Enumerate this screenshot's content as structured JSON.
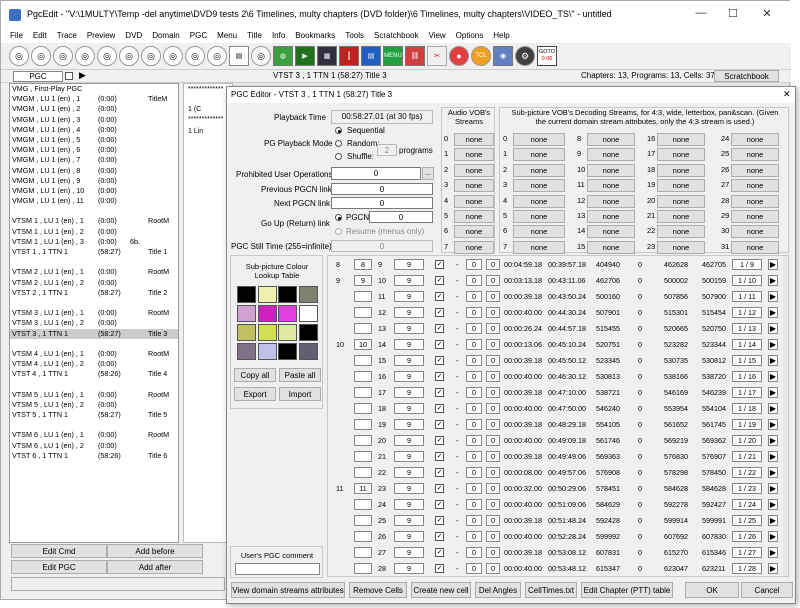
{
  "app": {
    "title": "PgcEdit -  \"V:\\1MULTY\\Temp -del anytime\\DVD9 tests 2\\6 Timelines, multy chapters (DVD folder)\\6 Timelines, multy chapters\\VIDEO_TS\\\" - untitled",
    "minimize": "—",
    "maximize": "☐",
    "close": "✕"
  },
  "menu": [
    "File",
    "Edit",
    "Trace",
    "Preview",
    "DVD",
    "Domain",
    "PGC",
    "Menu",
    "Title",
    "Info",
    "Bookmarks",
    "Tools",
    "Scratchbook",
    "View",
    "Options",
    "Help"
  ],
  "toolbar": {
    "goto_label": "GOTO",
    "goto_value": "0 06",
    "menu_btn": "MENU",
    "tcl_btn": "TCL"
  },
  "infobar": {
    "pgc_label": "PGC",
    "current": "VTST 3 , 1    TTN 1   (58:27)   Title 3",
    "stats": "Chapters: 13,  Programs: 13,  Cells: 37",
    "scratchbook": "Scratchbook"
  },
  "left_list": [
    {
      "a": "VMG , First-Play PGC",
      "b": "",
      "c": "",
      "d": ""
    },
    {
      "a": "VMGM , LU 1 (en) , 1",
      "b": "(0:00)",
      "c": "",
      "d": "TitleM"
    },
    {
      "a": "VMGM , LU 1 (en) , 2",
      "b": "(0:00)",
      "c": "",
      "d": ""
    },
    {
      "a": "VMGM , LU 1 (en) , 3",
      "b": "(0:00)",
      "c": "",
      "d": ""
    },
    {
      "a": "VMGM , LU 1 (en) , 4",
      "b": "(0:00)",
      "c": "",
      "d": ""
    },
    {
      "a": "VMGM , LU 1 (en) , 5",
      "b": "(0:00)",
      "c": "",
      "d": ""
    },
    {
      "a": "VMGM , LU 1 (en) , 6",
      "b": "(0:00)",
      "c": "",
      "d": ""
    },
    {
      "a": "VMGM , LU 1 (en) , 7",
      "b": "(0:00)",
      "c": "",
      "d": ""
    },
    {
      "a": "VMGM , LU 1 (en) , 8",
      "b": "(0:00)",
      "c": "",
      "d": ""
    },
    {
      "a": "VMGM , LU 1 (en) , 9",
      "b": "(0:00)",
      "c": "",
      "d": ""
    },
    {
      "a": "VMGM , LU 1 (en) , 10",
      "b": "(0:00)",
      "c": "",
      "d": ""
    },
    {
      "a": "VMGM , LU 1 (en) , 11",
      "b": "(0:00)",
      "c": "",
      "d": ""
    },
    null,
    {
      "a": "VTSM 1 , LU 1 (en) , 1",
      "b": "(0:00)",
      "c": "",
      "d": "RootM"
    },
    {
      "a": "VTSM 1 , LU 1 (en) , 2",
      "b": "(0:00)",
      "c": "",
      "d": ""
    },
    {
      "a": "VTSM 1 , LU 1 (en) , 3",
      "b": "(0:00)",
      "c": "6b.",
      "d": ""
    },
    {
      "a": "VTST 1 , 1     TTN 1",
      "b": "(58:27)",
      "c": "",
      "d": "Title 1"
    },
    null,
    {
      "a": "VTSM 2 , LU 1 (en) , 1",
      "b": "(0:00)",
      "c": "",
      "d": "RootM"
    },
    {
      "a": "VTSM 2 , LU 1 (en) , 2",
      "b": "(0:00)",
      "c": "",
      "d": ""
    },
    {
      "a": "VTST 2 , 1     TTN 1",
      "b": "(58:27)",
      "c": "",
      "d": "Title 2"
    },
    null,
    {
      "a": "VTSM 3 , LU 1 (en) , 1",
      "b": "(0:00)",
      "c": "",
      "d": "RootM"
    },
    {
      "a": "VTSM 3 , LU 1 (en) , 2",
      "b": "(0:00)",
      "c": "",
      "d": ""
    },
    {
      "a": "VTST 3 , 1     TTN 1",
      "b": "(58:27)",
      "c": "",
      "d": "Title 3",
      "sel": true
    },
    null,
    {
      "a": "VTSM 4 , LU 1 (en) , 1",
      "b": "(0:00)",
      "c": "",
      "d": "RootM"
    },
    {
      "a": "VTSM 4 , LU 1 (en) , 2",
      "b": "(0:00)",
      "c": "",
      "d": ""
    },
    {
      "a": "VTST 4 , 1     TTN 1",
      "b": "(58:26)",
      "c": "",
      "d": "Title 4"
    },
    null,
    {
      "a": "VTSM 5 , LU 1 (en) , 1",
      "b": "(0:00)",
      "c": "",
      "d": "RootM"
    },
    {
      "a": "VTSM 5 , LU 1 (en) , 2",
      "b": "(0:00)",
      "c": "",
      "d": ""
    },
    {
      "a": "VTST 5 , 1     TTN 1",
      "b": "(58:27)",
      "c": "",
      "d": "Title 5"
    },
    null,
    {
      "a": "VTSM 6 , LU 1 (en) , 1",
      "b": "(0:00)",
      "c": "",
      "d": "RootM"
    },
    {
      "a": "VTSM 6 , LU 1 (en) , 2",
      "b": "(0:00)",
      "c": "",
      "d": ""
    },
    {
      "a": "VTST 6 , 1     TTN 1",
      "b": "(58:26)",
      "c": "",
      "d": "Title 6"
    }
  ],
  "left_buttons": {
    "edit_cmd": "Edit Cmd",
    "add_before": "Add before",
    "edit_pgc": "Edit PGC",
    "add_after": "Add after"
  },
  "bg_text": {
    "stars1": "*************",
    "stars2": "*************",
    "line1": "1   (C",
    "line2": "1   Lin"
  },
  "dialog": {
    "title": "PGC Editor - VTST 3 , 1    TTN 1   (58:27)   Title 3",
    "playback_time_label": "Playback Time",
    "playback_time": "00:58:27.01 (at 30 fps)",
    "pg_mode_label": "PG Playback Mode",
    "sequential": "Sequential",
    "random": "Random:",
    "shuffle": "Shuffle:",
    "programs_value": "2",
    "programs_label": "programs",
    "prohibited_label": "Prohibited User Operations",
    "prohibited_value": "0",
    "prohibited_btn": "...",
    "prev_label": "Previous PGCN link",
    "prev_value": "0",
    "next_label": "Next PGCN link",
    "next_value": "0",
    "goup_label": "Go Up (Return) link",
    "pgcn_label": "PGCN",
    "pgcn_value": "0",
    "resume_label": "Resume (menus only)",
    "still_label": "PGC Still Time (255=infinite)",
    "still_value": "0",
    "audio_header": "Audio VOB's Streams",
    "audio": [
      [
        "0",
        "none"
      ],
      [
        "1",
        "none"
      ],
      [
        "2",
        "none"
      ],
      [
        "3",
        "none"
      ],
      [
        "4",
        "none"
      ],
      [
        "5",
        "none"
      ],
      [
        "6",
        "none"
      ],
      [
        "7",
        "none"
      ]
    ],
    "sub_header": "Sub-picture VOB's Decoding Streams, for 4:3, wide, letterbox, pan&scan. (Given the current domain stream attributes, only the 4:3 stream is used.)",
    "sub_cols": [
      [
        [
          "0",
          "none"
        ],
        [
          "1",
          "none"
        ],
        [
          "2",
          "none"
        ],
        [
          "3",
          "none"
        ],
        [
          "4",
          "none"
        ],
        [
          "5",
          "none"
        ],
        [
          "6",
          "none"
        ],
        [
          "7",
          "none"
        ]
      ],
      [
        [
          "8",
          "none"
        ],
        [
          "9",
          "none"
        ],
        [
          "10",
          "none"
        ],
        [
          "11",
          "none"
        ],
        [
          "12",
          "none"
        ],
        [
          "13",
          "none"
        ],
        [
          "14",
          "none"
        ],
        [
          "15",
          "none"
        ]
      ],
      [
        [
          "16",
          "none"
        ],
        [
          "17",
          "none"
        ],
        [
          "18",
          "none"
        ],
        [
          "19",
          "none"
        ],
        [
          "20",
          "none"
        ],
        [
          "21",
          "none"
        ],
        [
          "22",
          "none"
        ],
        [
          "23",
          "none"
        ]
      ],
      [
        [
          "24",
          "none"
        ],
        [
          "25",
          "none"
        ],
        [
          "26",
          "none"
        ],
        [
          "27",
          "none"
        ],
        [
          "28",
          "none"
        ],
        [
          "29",
          "none"
        ],
        [
          "30",
          "none"
        ],
        [
          "31",
          "none"
        ]
      ]
    ],
    "clut_title": "Sub-picture Colour Lookup Table",
    "clut_colors": [
      "#000000",
      "#f0f0b0",
      "#000000",
      "#808070",
      "#d0a0d0",
      "#d020c0",
      "#e040e0",
      "#ffffff",
      "#c0c060",
      "#d0e050",
      "#e0e8a0",
      "#000000",
      "#807088",
      "#c0c0e8",
      "#000000",
      "#606070"
    ],
    "copy_all": "Copy all",
    "paste_all": "Paste all",
    "export": "Export",
    "import": "Import",
    "comment_label": "User's PGC comment",
    "rows": [
      {
        "ch": "8",
        "pg": "8",
        "cell": "9",
        "v": "9",
        "a": "0",
        "b": "0",
        "t1": "00:04:59.18",
        "t2": "00:39:57.18",
        "s1": "404940",
        "s2": "0",
        "s3": "462628",
        "s4": "462705",
        "frac": "1 / 9"
      },
      {
        "ch": "9",
        "pg": "9",
        "cell": "10",
        "v": "9",
        "a": "0",
        "b": "0",
        "t1": "00:03:13.18",
        "t2": "00:43:11.06",
        "s1": "462706",
        "s2": "0",
        "s3": "500002",
        "s4": "500159",
        "frac": "1 / 10"
      },
      {
        "ch": "",
        "pg": "",
        "cell": "11",
        "v": "9",
        "a": "0",
        "b": "0",
        "t1": "00:00:39.18",
        "t2": "00:43:50.24",
        "s1": "500160",
        "s2": "0",
        "s3": "507856",
        "s4": "507900",
        "frac": "1 / 11"
      },
      {
        "ch": "",
        "pg": "",
        "cell": "12",
        "v": "9",
        "a": "0",
        "b": "0",
        "t1": "00:00:40.00",
        "t2": "00:44:30.24",
        "s1": "507901",
        "s2": "0",
        "s3": "515301",
        "s4": "515454",
        "frac": "1 / 12"
      },
      {
        "ch": "",
        "pg": "",
        "cell": "13",
        "v": "9",
        "a": "0",
        "b": "0",
        "t1": "00:00:26.24",
        "t2": "00:44:57.18",
        "s1": "515455",
        "s2": "0",
        "s3": "520665",
        "s4": "520750",
        "frac": "1 / 13"
      },
      {
        "ch": "10",
        "pg": "10",
        "cell": "14",
        "v": "9",
        "a": "0",
        "b": "0",
        "t1": "00:00:13.06",
        "t2": "00:45:10.24",
        "s1": "520751",
        "s2": "0",
        "s3": "523282",
        "s4": "523344",
        "frac": "1 / 14"
      },
      {
        "ch": "",
        "pg": "",
        "cell": "15",
        "v": "9",
        "a": "0",
        "b": "0",
        "t1": "00:00:39.18",
        "t2": "00:45:50.12",
        "s1": "523345",
        "s2": "0",
        "s3": "530735",
        "s4": "530812",
        "frac": "1 / 15"
      },
      {
        "ch": "",
        "pg": "",
        "cell": "16",
        "v": "9",
        "a": "0",
        "b": "0",
        "t1": "00:00:40.00",
        "t2": "00:46:30.12",
        "s1": "530813",
        "s2": "0",
        "s3": "538166",
        "s4": "538720",
        "frac": "1 / 16"
      },
      {
        "ch": "",
        "pg": "",
        "cell": "17",
        "v": "9",
        "a": "0",
        "b": "0",
        "t1": "00:00:39.18",
        "t2": "00:47:10.00",
        "s1": "538721",
        "s2": "0",
        "s3": "546169",
        "s4": "546239",
        "frac": "1 / 17"
      },
      {
        "ch": "",
        "pg": "",
        "cell": "18",
        "v": "9",
        "a": "0",
        "b": "0",
        "t1": "00:00:40.00",
        "t2": "00:47:50.00",
        "s1": "546240",
        "s2": "0",
        "s3": "553954",
        "s4": "554104",
        "frac": "1 / 18"
      },
      {
        "ch": "",
        "pg": "",
        "cell": "19",
        "v": "9",
        "a": "0",
        "b": "0",
        "t1": "00:00:39.18",
        "t2": "00:48:29.18",
        "s1": "554105",
        "s2": "0",
        "s3": "561652",
        "s4": "561745",
        "frac": "1 / 19"
      },
      {
        "ch": "",
        "pg": "",
        "cell": "20",
        "v": "9",
        "a": "0",
        "b": "0",
        "t1": "00:00:40.00",
        "t2": "00:49:09.18",
        "s1": "561746",
        "s2": "0",
        "s3": "569219",
        "s4": "569362",
        "frac": "1 / 20"
      },
      {
        "ch": "",
        "pg": "",
        "cell": "21",
        "v": "9",
        "a": "0",
        "b": "0",
        "t1": "00:00:39.18",
        "t2": "00:49:49.06",
        "s1": "569363",
        "s2": "0",
        "s3": "576830",
        "s4": "576907",
        "frac": "1 / 21"
      },
      {
        "ch": "",
        "pg": "",
        "cell": "22",
        "v": "9",
        "a": "0",
        "b": "0",
        "t1": "00:00:08.00",
        "t2": "00:49:57.06",
        "s1": "576908",
        "s2": "0",
        "s3": "578298",
        "s4": "578450",
        "frac": "1 / 22"
      },
      {
        "ch": "11",
        "pg": "11",
        "cell": "23",
        "v": "9",
        "a": "0",
        "b": "0",
        "t1": "00:00:32.00",
        "t2": "00:50:29.06",
        "s1": "578451",
        "s2": "0",
        "s3": "584628",
        "s4": "584628",
        "frac": "1 / 23"
      },
      {
        "ch": "",
        "pg": "",
        "cell": "24",
        "v": "9",
        "a": "0",
        "b": "0",
        "t1": "00:00:40.00",
        "t2": "00:51:09.06",
        "s1": "584629",
        "s2": "0",
        "s3": "592278",
        "s4": "592427",
        "frac": "1 / 24"
      },
      {
        "ch": "",
        "pg": "",
        "cell": "25",
        "v": "9",
        "a": "0",
        "b": "0",
        "t1": "00:00:39.18",
        "t2": "00:51:48.24",
        "s1": "592428",
        "s2": "0",
        "s3": "599914",
        "s4": "599991",
        "frac": "1 / 25"
      },
      {
        "ch": "",
        "pg": "",
        "cell": "26",
        "v": "9",
        "a": "0",
        "b": "0",
        "t1": "00:00:40.00",
        "t2": "00:52:28.24",
        "s1": "599992",
        "s2": "0",
        "s3": "607692",
        "s4": "607830",
        "frac": "1 / 26"
      },
      {
        "ch": "",
        "pg": "",
        "cell": "27",
        "v": "9",
        "a": "0",
        "b": "0",
        "t1": "00:00:39.18",
        "t2": "00:53:08.12",
        "s1": "607831",
        "s2": "0",
        "s3": "615270",
        "s4": "615346",
        "frac": "1 / 27"
      },
      {
        "ch": "",
        "pg": "",
        "cell": "28",
        "v": "9",
        "a": "0",
        "b": "0",
        "t1": "00:00:40.00",
        "t2": "00:53:48.12",
        "s1": "615347",
        "s2": "0",
        "s3": "623047",
        "s4": "623211",
        "frac": "1 / 28"
      }
    ],
    "dash": "-",
    "arrow": "▶",
    "bottom": {
      "view_streams": "View domain streams attributes",
      "remove_cells": "Remove Cells",
      "create_cell": "Create new cell",
      "del_angles": "Del Angles",
      "celltimes": "CellTimes.txt",
      "edit_chapter": "Edit Chapter (PTT) table",
      "ok": "OK",
      "cancel": "Cancel"
    },
    "close": "✕"
  }
}
